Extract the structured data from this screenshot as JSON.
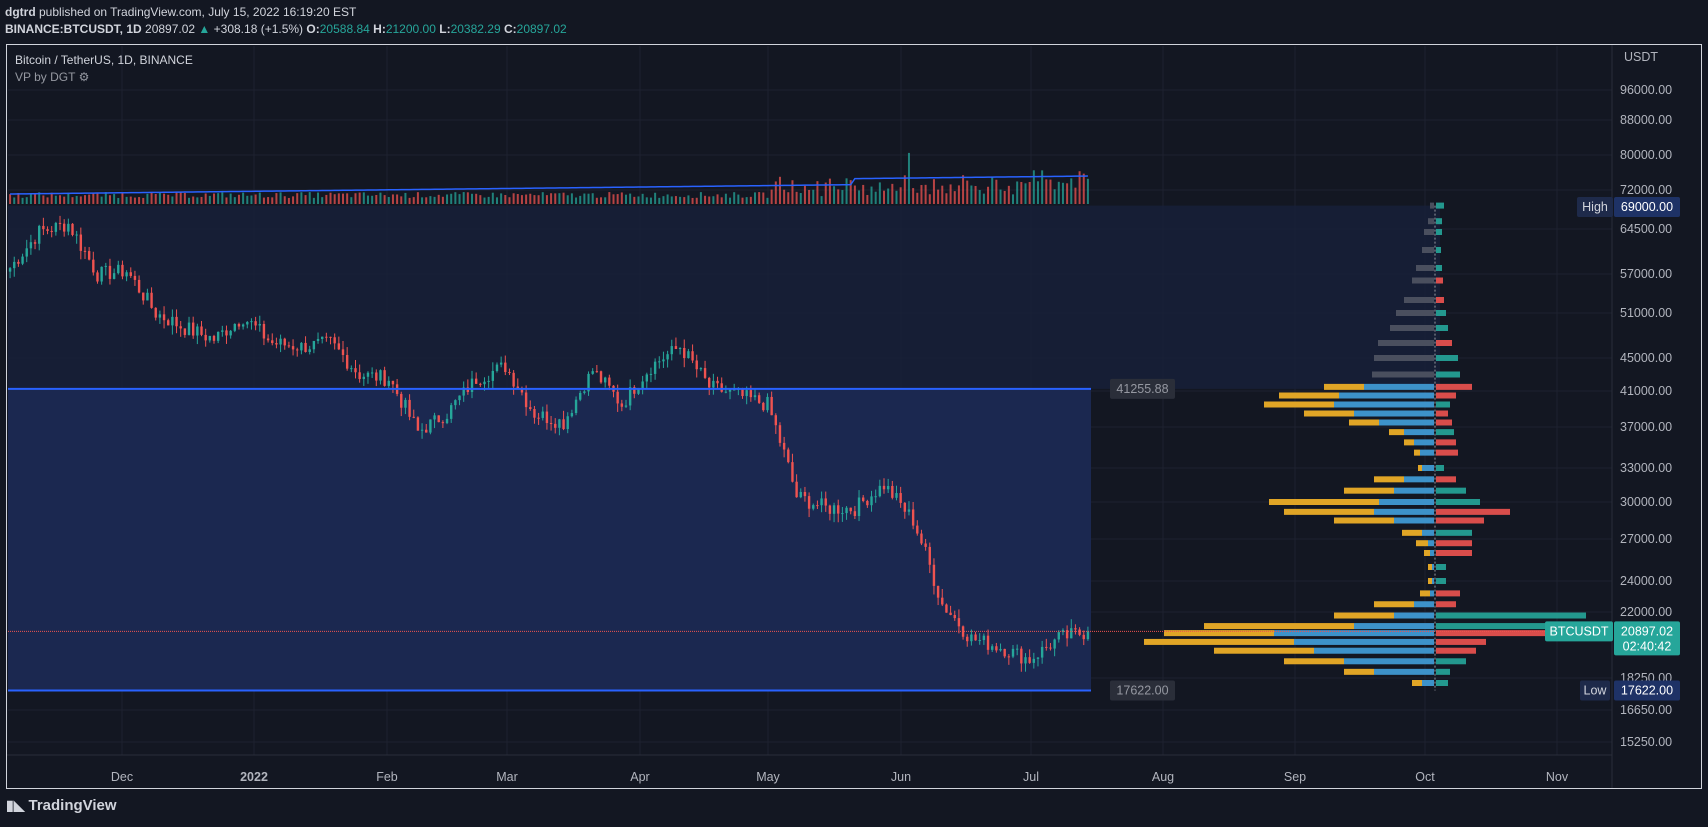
{
  "header": {
    "publisher": "dgtrd",
    "published_text": "published on TradingView.com, July 15, 2022 16:19:20 EST",
    "symbol_line": "BINANCE:BTCUSDT, 1D",
    "last": "20897.02",
    "change_arrow": "▲",
    "change": "+308.18 (+1.5%)",
    "o_label": "O:",
    "o": "20588.84",
    "h_label": "H:",
    "h": "21200.00",
    "l_label": "L:",
    "l": "20382.29",
    "c_label": "C:",
    "c": "20897.02"
  },
  "legend": {
    "title": "Bitcoin / TetherUS, 1D, BINANCE",
    "indicator": "VP by DGT"
  },
  "branding": {
    "logo_text": "TradingView"
  },
  "chart_data": {
    "type": "candlestick",
    "currency_label": "USDT",
    "y_ticks": [
      "96000.00",
      "88000.00",
      "80000.00",
      "72000.00",
      "64500.00",
      "57000.00",
      "51000.00",
      "45000.00",
      "41000.00",
      "37000.00",
      "33000.00",
      "30000.00",
      "27000.00",
      "24000.00",
      "22000.00",
      "18250.00",
      "16650.00",
      "15250.00"
    ],
    "x_ticks": [
      "Dec",
      "2022",
      "Feb",
      "Mar",
      "Apr",
      "May",
      "Jun",
      "Jul",
      "Aug",
      "Sep",
      "Oct",
      "Nov"
    ],
    "high_label": "High",
    "high_value": "69000.00",
    "low_label": "Low",
    "low_value": "17622.00",
    "last_symbol": "BTCUSDT",
    "last_price": "20897.02",
    "countdown": "02:40:42",
    "level_upper": "41255.88",
    "level_lower": "17622.00",
    "colors": {
      "up": "#26a69a",
      "down": "#ef5350",
      "box": "#1d2a52",
      "level": "#2962ff",
      "vp_orange": "#e0a526",
      "vp_blue": "#3d92c9",
      "vol_ma": "#2962ff"
    },
    "candles_weekly_close": [
      58000,
      64000,
      65500,
      57000,
      57500,
      51000,
      49000,
      47500,
      50500,
      47000,
      46500,
      47000,
      43000,
      42500,
      36500,
      38500,
      42500,
      44000,
      38500,
      37500,
      43500,
      39500,
      44000,
      46500,
      41500,
      40500,
      39500,
      30500,
      29500,
      29500,
      31500,
      28500,
      22500,
      20500,
      20000,
      19300,
      20500,
      20897
    ]
  }
}
